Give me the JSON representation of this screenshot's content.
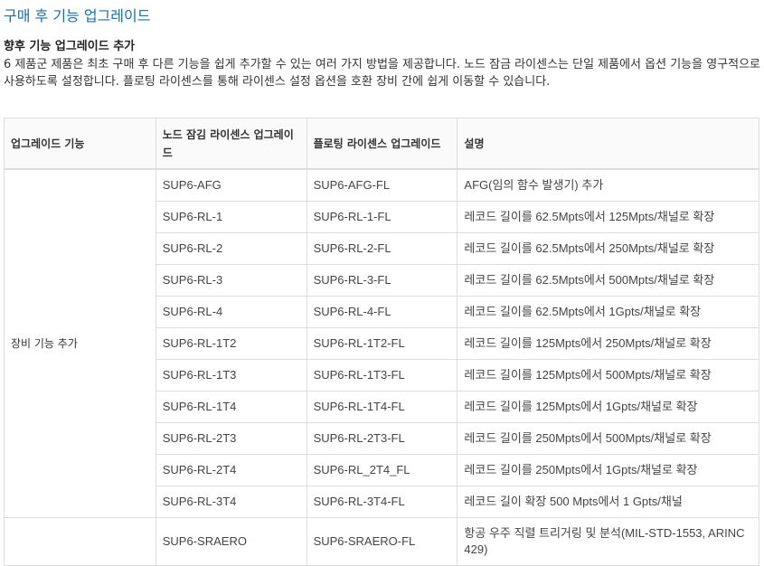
{
  "page_title": "구매 후 기능 업그레이드",
  "section": {
    "heading": "향후 기능 업그레이드 추가",
    "intro": "6 제품군 제품은 최초 구매 후 다른 기능을 쉽게 추가할 수 있는 여러 가지 방법을 제공합니다. 노드 잠금 라이센스는 단일 제품에서 옵션 기능을 영구적으로 사용하도록 설정합니다. 플로팅 라이센스를 통해 라이센스 설정 옵션을 호환 장비 간에 쉽게 이동할 수 있습니다."
  },
  "table": {
    "headers": [
      "업그레이드 기능",
      "노드 잠김 라이센스 업그레이드",
      "플로팅 라이센스 업그레이드",
      "설명"
    ],
    "groups": [
      {
        "label": "장비 기능 추가",
        "rows": [
          {
            "node": "SUP6-AFG",
            "float": "SUP6-AFG-FL",
            "desc": "AFG(임의 함수 발생기) 추가"
          },
          {
            "node": "SUP6-RL-1",
            "float": "SUP6-RL-1-FL",
            "desc": "레코드 길이를 62.5Mpts에서 125Mpts/채널로 확장"
          },
          {
            "node": "SUP6-RL-2",
            "float": "SUP6-RL-2-FL",
            "desc": "레코드 길이를 62.5Mpts에서 250Mpts/채널로 확장"
          },
          {
            "node": "SUP6-RL-3",
            "float": "SUP6-RL-3-FL",
            "desc": "레코드 길이를 62.5Mpts에서 500Mpts/채널로 확장"
          },
          {
            "node": "SUP6-RL-4",
            "float": "SUP6-RL-4-FL",
            "desc": "레코드 길이를 62.5Mpts에서 1Gpts/채널로 확장"
          },
          {
            "node": "SUP6-RL-1T2",
            "float": "SUP6-RL-1T2-FL",
            "desc": "레코드 길이를 125Mpts에서 250Mpts/채널로 확장"
          },
          {
            "node": "SUP6-RL-1T3",
            "float": "SUP6-RL-1T3-FL",
            "desc": "레코드 길이를 125Mpts에서 500Mpts/채널로 확장"
          },
          {
            "node": "SUP6-RL-1T4",
            "float": "SUP6-RL-1T4-FL",
            "desc": "레코드 길이를 125Mpts에서 1Gpts/채널로 확장"
          },
          {
            "node": "SUP6-RL-2T3",
            "float": "SUP6-RL-2T3-FL",
            "desc": "레코드 길이를 250Mpts에서 500Mpts/채널로 확장"
          },
          {
            "node": "SUP6-RL-2T4",
            "float": "SUP6-RL_2T4_FL",
            "desc": "레코드 길이를 250Mpts에서 1Gpts/채널로 확장"
          },
          {
            "node": "SUP6-RL-3T4",
            "float": "SUP6-RL-3T4-FL",
            "desc": "레코드 길이 확장 500 Mpts에서 1 Gpts/채널"
          }
        ]
      },
      {
        "label": "",
        "rows": [
          {
            "node": "SUP6-SRAERO",
            "float": "SUP6-SRAERO-FL",
            "desc": "항공 우주 직렬 트리거링 및 분석(MIL-STD-1553, ARINC 429)"
          }
        ]
      }
    ]
  }
}
